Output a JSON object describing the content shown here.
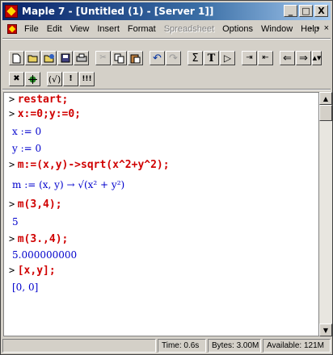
{
  "window": {
    "title": "Maple 7 - [Untitled (1) - [Server 1]]",
    "controls": {
      "minimize": "_",
      "maximize": "□",
      "close": "X"
    }
  },
  "menubar": {
    "items": [
      "File",
      "Edit",
      "View",
      "Insert",
      "Format",
      "Spreadsheet",
      "Options",
      "Window",
      "Help"
    ],
    "mdi_controls": [
      "-",
      "▫",
      "×"
    ]
  },
  "toolbar1": {
    "buttons": [
      "new",
      "open",
      "open-url",
      "save",
      "print",
      "cut",
      "copy",
      "paste",
      "undo",
      "redo",
      "sum",
      "text",
      "exec",
      "indent",
      "outdent",
      "back",
      "forward",
      "stop"
    ]
  },
  "toolbar2": {
    "buttons": [
      "stop-x",
      "debug",
      "check",
      "exclam",
      "triple-exclam"
    ]
  },
  "worksheet": {
    "prompt": ">",
    "lines": [
      {
        "kind": "input",
        "text": "restart;"
      },
      {
        "kind": "input",
        "text": "x:=0;y:=0;"
      },
      {
        "kind": "output",
        "text": "x := 0"
      },
      {
        "kind": "output",
        "text": "y := 0"
      },
      {
        "kind": "input",
        "text": "m:=(x,y)->sqrt(x^2+y^2);"
      },
      {
        "kind": "output",
        "text": "m := (x, y) → √(x² + y²)"
      },
      {
        "kind": "input",
        "text": "m(3,4);"
      },
      {
        "kind": "output",
        "text": "5"
      },
      {
        "kind": "input",
        "text": "m(3.,4);"
      },
      {
        "kind": "output",
        "text": "5.000000000"
      },
      {
        "kind": "input",
        "text": "[x,y];"
      },
      {
        "kind": "output",
        "text": "[0, 0]"
      }
    ]
  },
  "statusbar": {
    "time": "Time: 0.6s",
    "bytes": "Bytes: 3.00M",
    "available": "Available: 121M"
  }
}
